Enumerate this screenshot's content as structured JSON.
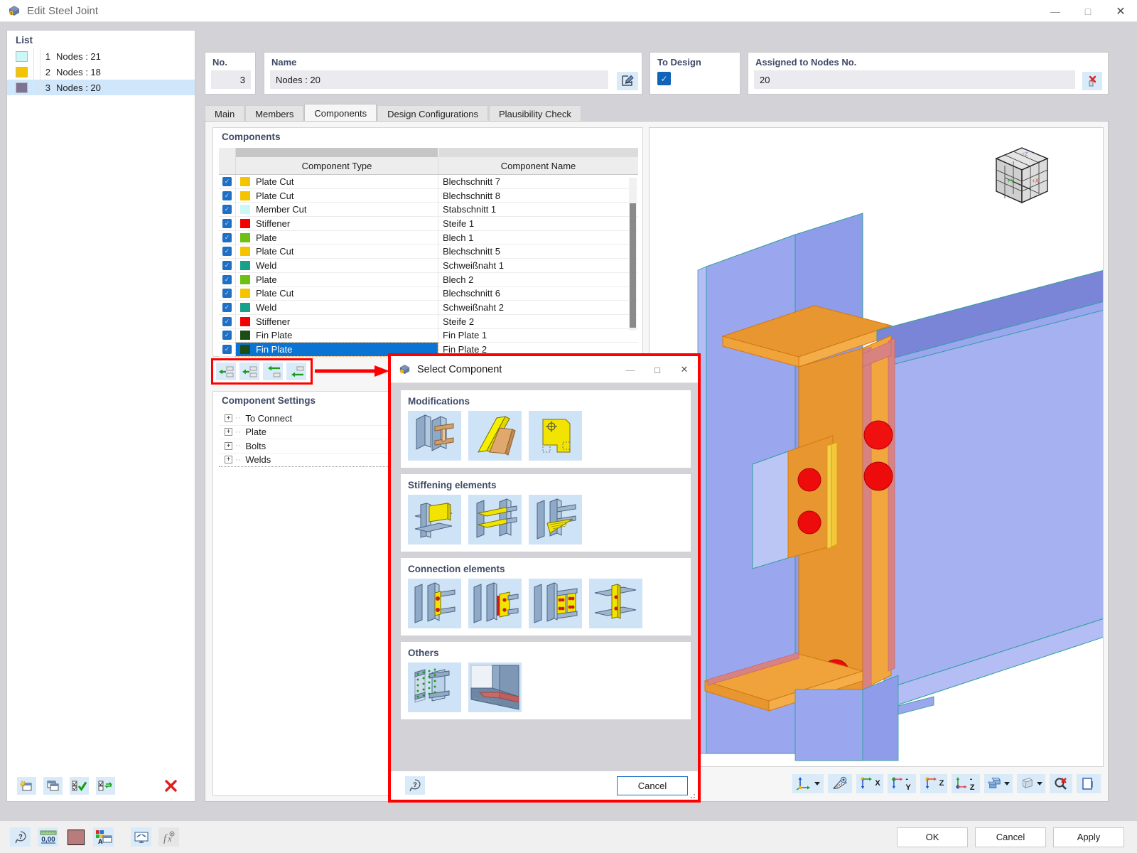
{
  "window": {
    "title": "Edit Steel Joint",
    "icon": "steel-joint-icon",
    "minimize": "—",
    "maximize": "□",
    "close": "✕"
  },
  "list_panel": {
    "title": "List",
    "items": [
      {
        "num": "1",
        "label": "Nodes : 21",
        "color": "#ccf7f7",
        "selected": false
      },
      {
        "num": "2",
        "label": "Nodes : 18",
        "color": "#f5c400",
        "selected": false
      },
      {
        "num": "3",
        "label": "Nodes : 20",
        "color": "#7d7395",
        "selected": true
      }
    ],
    "toolbar": [
      {
        "name": "new-joint-button",
        "glyph": "new"
      },
      {
        "name": "copy-joint-button",
        "glyph": "copy"
      },
      {
        "name": "select-all-button",
        "glyph": "check-all"
      },
      {
        "name": "invert-selection-button",
        "glyph": "invert"
      },
      {
        "name": "delete-joint-button",
        "glyph": "delete"
      }
    ]
  },
  "form": {
    "no_label": "No.",
    "no_value": "3",
    "name_label": "Name",
    "name_value": "Nodes : 20",
    "name_edit_icon": "edit-pencil-icon",
    "to_design_label": "To Design",
    "to_design_checked": true,
    "nodes_label": "Assigned to Nodes No.",
    "nodes_value": "20",
    "nodes_clear_icon": "delete-red-x-icon"
  },
  "tabs": [
    {
      "label": "Main",
      "active": false
    },
    {
      "label": "Members",
      "active": false
    },
    {
      "label": "Components",
      "active": true
    },
    {
      "label": "Design Configurations",
      "active": false
    },
    {
      "label": "Plausibility Check",
      "active": false
    }
  ],
  "components_group": {
    "title": "Components",
    "columns": [
      "Component Type",
      "Component Name"
    ],
    "rows": [
      {
        "checked": true,
        "color": "#f5c400",
        "type": "Plate Cut",
        "name": "Blechschnitt 7",
        "selected": false
      },
      {
        "checked": true,
        "color": "#f5c400",
        "type": "Plate Cut",
        "name": "Blechschnitt 8",
        "selected": false
      },
      {
        "checked": true,
        "color": "#ccf7f7",
        "type": "Member Cut",
        "name": "Stabschnitt 1",
        "selected": false
      },
      {
        "checked": true,
        "color": "#f40000",
        "type": "Stiffener",
        "name": "Steife 1",
        "selected": false
      },
      {
        "checked": true,
        "color": "#6ec014",
        "type": "Plate",
        "name": "Blech 1",
        "selected": false
      },
      {
        "checked": true,
        "color": "#f5c400",
        "type": "Plate Cut",
        "name": "Blechschnitt 5",
        "selected": false
      },
      {
        "checked": true,
        "color": "#17a08c",
        "type": "Weld",
        "name": "Schweißnaht 1",
        "selected": false
      },
      {
        "checked": true,
        "color": "#6ec014",
        "type": "Plate",
        "name": "Blech 2",
        "selected": false
      },
      {
        "checked": true,
        "color": "#f5c400",
        "type": "Plate Cut",
        "name": "Blechschnitt 6",
        "selected": false
      },
      {
        "checked": true,
        "color": "#17a08c",
        "type": "Weld",
        "name": "Schweißnaht 2",
        "selected": false
      },
      {
        "checked": true,
        "color": "#f40000",
        "type": "Stiffener",
        "name": "Steife 2",
        "selected": false
      },
      {
        "checked": true,
        "color": "#1d4d16",
        "type": "Fin Plate",
        "name": "Fin Plate 1",
        "selected": false
      },
      {
        "checked": true,
        "color": "#1d4d16",
        "type": "Fin Plate",
        "name": "Fin Plate 2",
        "selected": true
      }
    ]
  },
  "component_nav_toolbar": {
    "highlight_color": "#ff0000",
    "buttons": [
      {
        "name": "move-component-first-button",
        "glyph": "arrow-left-1"
      },
      {
        "name": "move-component-up-button",
        "glyph": "arrow-left-2"
      },
      {
        "name": "move-component-down-button",
        "glyph": "arrow-left-3"
      },
      {
        "name": "move-component-last-button",
        "glyph": "arrow-left-4"
      }
    ]
  },
  "settings_group": {
    "title": "Component Settings",
    "nodes": [
      {
        "label": "To Connect"
      },
      {
        "label": "Plate"
      },
      {
        "label": "Bolts"
      },
      {
        "label": "Welds"
      }
    ]
  },
  "viewport": {
    "nav_cube": "view-cube-icon",
    "axis_y_label": "Y",
    "axis_z_label": "Z",
    "toolbar": [
      {
        "name": "coordinate-system-button",
        "cap": "",
        "glyph": "axes",
        "caret": true
      },
      {
        "name": "measure-button",
        "cap": "",
        "glyph": "ruler",
        "caret": false
      },
      {
        "name": "view-x-button",
        "cap": "X",
        "glyph": "axis-x",
        "caret": false
      },
      {
        "name": "view-y-button",
        "cap": "-Y",
        "glyph": "axis-y",
        "caret": false
      },
      {
        "name": "view-z-button",
        "cap": "Z",
        "glyph": "axis-z",
        "caret": false
      },
      {
        "name": "view-negz-button",
        "cap": "-Z",
        "glyph": "axis-negz",
        "caret": false
      },
      {
        "name": "render-mode-button",
        "cap": "",
        "glyph": "solid",
        "caret": true
      },
      {
        "name": "wireframe-button",
        "cap": "",
        "glyph": "wire",
        "caret": true
      },
      {
        "name": "zoom-reset-button",
        "cap": "",
        "glyph": "zoom-x",
        "caret": false
      },
      {
        "name": "print-view-button",
        "cap": "",
        "glyph": "page",
        "caret": false
      }
    ]
  },
  "select_component_dialog": {
    "title": "Select Component",
    "icon": "steel-joint-icon",
    "minimize": "—",
    "maximize": "□",
    "close": "✕",
    "border_color": "#ff0000",
    "sections": [
      {
        "title": "Modifications",
        "items": [
          {
            "name": "member-cut-item"
          },
          {
            "name": "plate-cut-item"
          },
          {
            "name": "plate-contour-cut-item"
          }
        ]
      },
      {
        "title": "Stiffening elements",
        "items": [
          {
            "name": "stiffener-item"
          },
          {
            "name": "double-stiffener-item"
          },
          {
            "name": "haunch-item"
          }
        ]
      },
      {
        "title": "Connection elements",
        "items": [
          {
            "name": "fin-plate-item"
          },
          {
            "name": "end-plate-item"
          },
          {
            "name": "splice-plate-item"
          },
          {
            "name": "cleat-angle-item"
          }
        ]
      },
      {
        "title": "Others",
        "items": [
          {
            "name": "surface-mesh-item"
          },
          {
            "name": "weld-seam-item"
          }
        ]
      }
    ],
    "help_icon": "help-icon",
    "cancel_label": "Cancel"
  },
  "statusbar": {
    "left_buttons": [
      {
        "name": "help-button",
        "glyph": "help"
      },
      {
        "name": "units-button",
        "glyph": "units",
        "cap": "0,00"
      },
      {
        "name": "color-swatch-button",
        "glyph": "swatch",
        "color": "#b97c7c"
      },
      {
        "name": "display-properties-button",
        "glyph": "display"
      },
      {
        "name": "render-settings-button",
        "glyph": "render"
      },
      {
        "name": "formula-button",
        "glyph": "fx",
        "disabled": true
      }
    ],
    "dialog_buttons": [
      {
        "name": "ok-button",
        "label": "OK"
      },
      {
        "name": "cancel-button",
        "label": "Cancel"
      },
      {
        "name": "apply-button",
        "label": "Apply"
      }
    ]
  }
}
